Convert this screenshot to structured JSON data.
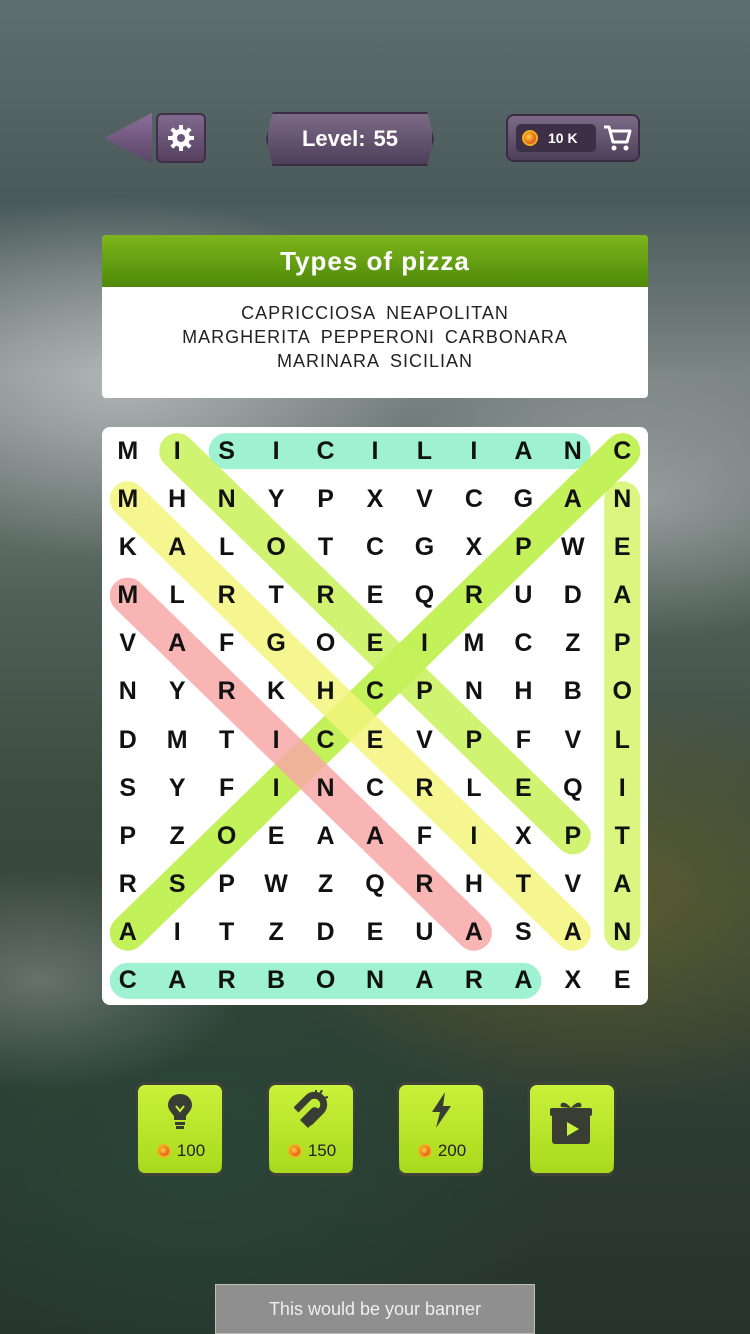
{
  "header": {
    "level_label": "Level:",
    "level_value": "55",
    "coins": "10 K"
  },
  "category": {
    "title": "Types of pizza",
    "word_lines": [
      [
        "CAPRICCIOSA",
        "NEAPOLITAN"
      ],
      [
        "MARGHERITA",
        "PEPPERONI",
        "CARBONARA"
      ],
      [
        "MARINARA",
        "SICILIAN"
      ]
    ]
  },
  "grid": {
    "rows": [
      [
        "M",
        "I",
        "S",
        "I",
        "C",
        "I",
        "L",
        "I",
        "A",
        "N",
        "C"
      ],
      [
        "M",
        "H",
        "N",
        "Y",
        "P",
        "X",
        "V",
        "C",
        "G",
        "A",
        "N"
      ],
      [
        "K",
        "A",
        "L",
        "O",
        "T",
        "C",
        "G",
        "X",
        "P",
        "W",
        "E"
      ],
      [
        "M",
        "L",
        "R",
        "T",
        "R",
        "E",
        "Q",
        "R",
        "U",
        "D",
        "A"
      ],
      [
        "V",
        "A",
        "F",
        "G",
        "O",
        "E",
        "I",
        "M",
        "C",
        "Z",
        "P"
      ],
      [
        "N",
        "Y",
        "R",
        "K",
        "H",
        "C",
        "P",
        "N",
        "H",
        "B",
        "O"
      ],
      [
        "D",
        "M",
        "T",
        "I",
        "C",
        "E",
        "V",
        "P",
        "F",
        "V",
        "L"
      ],
      [
        "S",
        "Y",
        "F",
        "I",
        "N",
        "C",
        "R",
        "L",
        "E",
        "Q",
        "I"
      ],
      [
        "P",
        "Z",
        "O",
        "E",
        "A",
        "A",
        "F",
        "I",
        "X",
        "P",
        "T"
      ],
      [
        "R",
        "S",
        "P",
        "W",
        "Z",
        "Q",
        "R",
        "H",
        "T",
        "V",
        "A"
      ],
      [
        "A",
        "I",
        "T",
        "Z",
        "D",
        "E",
        "U",
        "A",
        "S",
        "A",
        "N"
      ],
      [
        "C",
        "A",
        "R",
        "B",
        "O",
        "N",
        "A",
        "R",
        "A",
        "X",
        "E"
      ]
    ],
    "found_words": [
      {
        "word": "SICILIAN",
        "start": [
          0,
          2
        ],
        "end": [
          0,
          9
        ],
        "color": "#8ff0c9"
      },
      {
        "word": "CARBONARA",
        "start": [
          11,
          0
        ],
        "end": [
          11,
          8
        ],
        "color": "#8ff0c9"
      },
      {
        "word": "NEAPOLITAN",
        "start": [
          1,
          10
        ],
        "end": [
          10,
          10
        ],
        "color": "#d4f56a"
      },
      {
        "word": "CAPRICCIOSA",
        "start": [
          0,
          10
        ],
        "end": [
          10,
          0
        ],
        "color": "#b9ef3e"
      },
      {
        "word": "PEPPERONI",
        "start": [
          0,
          1
        ],
        "end": [
          8,
          9
        ],
        "color": "#c8f25a"
      },
      {
        "word": "MARGHERITA",
        "start": [
          1,
          0
        ],
        "end": [
          10,
          9
        ],
        "color": "#f4f57c"
      },
      {
        "word": "MARINARA",
        "start": [
          3,
          0
        ],
        "end": [
          10,
          7
        ],
        "color": "#f7a9a6"
      }
    ]
  },
  "boosters": [
    {
      "name": "hint",
      "icon": "lightbulb-icon",
      "price": "100"
    },
    {
      "name": "magnet",
      "icon": "magnet-icon",
      "price": "150"
    },
    {
      "name": "lightning",
      "icon": "lightning-icon",
      "price": "200"
    },
    {
      "name": "video",
      "icon": "gift-video-icon",
      "price": ""
    }
  ],
  "banner": {
    "text": "This would be your banner"
  }
}
